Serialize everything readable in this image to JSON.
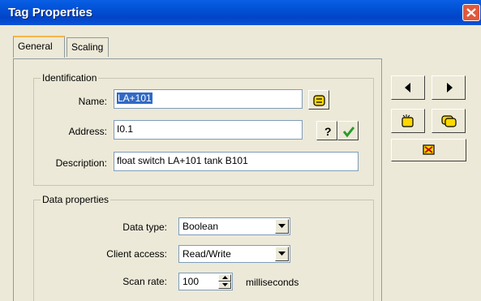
{
  "window": {
    "title": "Tag Properties"
  },
  "tabs": [
    {
      "label": "General",
      "active": true
    },
    {
      "label": "Scaling",
      "active": false
    }
  ],
  "identification": {
    "group_title": "Identification",
    "name": {
      "label": "Name:",
      "value": "LA+101"
    },
    "address": {
      "label": "Address:",
      "value": "I0.1"
    },
    "description": {
      "label": "Description:",
      "value": "float switch LA+101 tank B101"
    }
  },
  "data_properties": {
    "group_title": "Data properties",
    "data_type": {
      "label": "Data type:",
      "value": "Boolean"
    },
    "client_access": {
      "label": "Client access:",
      "value": "Read/Write"
    },
    "scan_rate": {
      "label": "Scan rate:",
      "value": "100",
      "unit": "milliseconds"
    }
  },
  "icons": {
    "name_browse": "tag-browse-icon",
    "address_help": "question-icon",
    "address_check": "checkmark-icon",
    "prev": "left-arrow-icon",
    "next": "right-arrow-icon",
    "new_tag": "new-tag-icon",
    "copy_tag": "copy-tag-icon",
    "delete_tag": "delete-tag-icon"
  },
  "colors": {
    "title_bar": "#0254d8",
    "selection": "#316ac5",
    "tab_highlight": "#f5b64a",
    "check_green": "#2a9a2a"
  }
}
